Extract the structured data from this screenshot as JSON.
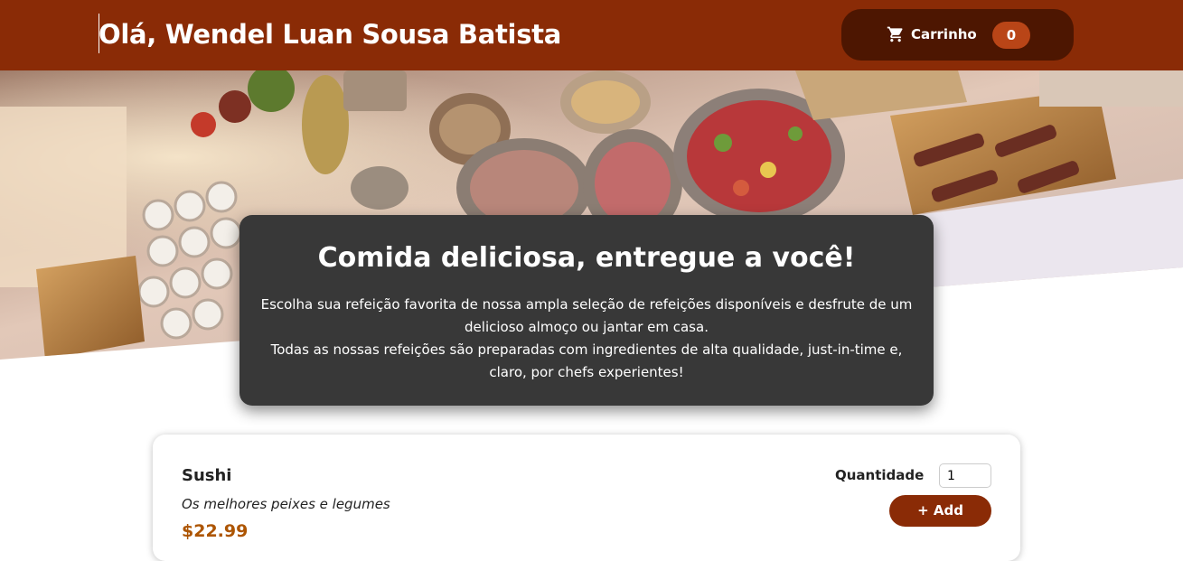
{
  "header": {
    "greeting": "Olá, Wendel Luan Sousa Batista",
    "cart": {
      "label": "Carrinho",
      "count": "0",
      "icon": "cart-icon"
    }
  },
  "hero": {
    "image": "buffet-food-table-photo"
  },
  "summary": {
    "title": "Comida deliciosa, entregue a você!",
    "paragraph1": "Escolha sua refeição favorita de nossa ampla seleção de refeições disponíveis e desfrute de um delicioso almoço ou jantar em casa.",
    "paragraph2": "Todas as nossas refeições são preparadas com ingredientes de alta qualidade, just-in-time e, claro, por chefs experientes!"
  },
  "meals": [
    {
      "name": "Sushi",
      "description": "Os melhores peixes e legumes",
      "price": "$22.99",
      "quantity_label": "Quantidade",
      "quantity_value": "1",
      "add_label": "+ Add"
    }
  ],
  "colors": {
    "header": "#8a2b06",
    "cart_button": "#4d1601",
    "badge": "#b94517",
    "summary_bg": "#383838",
    "price": "#ad5502"
  }
}
